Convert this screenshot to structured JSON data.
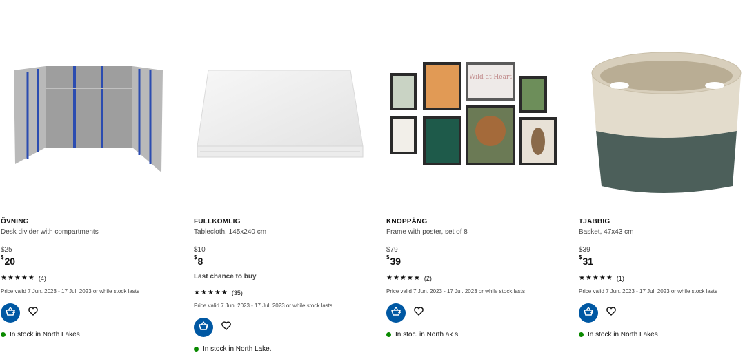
{
  "products": [
    {
      "name": "ÖVNING",
      "description": "Desk divider with compartments",
      "old_price": "$25",
      "currency": "$",
      "price": "20",
      "rating_count": "(4)",
      "validity": "Price valid 7 Jun. 2023 - 17 Jul. 2023 or while stock lasts",
      "stock": "In stock in North Lakes",
      "image_icon": "desk-divider-image"
    },
    {
      "name": "FULLKOMLIG",
      "description": "Tablecloth, 145x240 cm",
      "old_price": "$10",
      "currency": "$",
      "price": "8",
      "badge": "Last chance to buy",
      "rating_count": "(35)",
      "validity": "Price valid 7 Jun. 2023 - 17 Jul. 2023 or while stock lasts",
      "stock": "In stock in North Lake.",
      "image_icon": "tablecloth-image"
    },
    {
      "name": "KNOPPÄNG",
      "description": "Frame with poster, set of 8",
      "old_price": "$79",
      "currency": "$",
      "price": "39",
      "rating_count": "(2)",
      "validity": "Price valid 7 Jun. 2023 - 17 Jul. 2023 or while stock lasts",
      "stock": "In stoc. in North ak s",
      "image_icon": "poster-frames-image",
      "poster_text": "Wild at Heart"
    },
    {
      "name": "TJABBIG",
      "description": "Basket, 47x43 cm",
      "old_price": "$39",
      "currency": "$",
      "price": "31",
      "rating_count": "(1)",
      "validity": "Price valid 7 Jun. 2023 - 17 Jul. 2023 or while stock lasts",
      "stock": "In stock in North Lakes",
      "image_icon": "basket-image"
    }
  ],
  "colors": {
    "accent": "#0058a3",
    "in_stock": "#0a8a00"
  },
  "icons": {
    "cart": "add-to-cart-icon",
    "favourite": "heart-icon",
    "star": "star-icon"
  }
}
